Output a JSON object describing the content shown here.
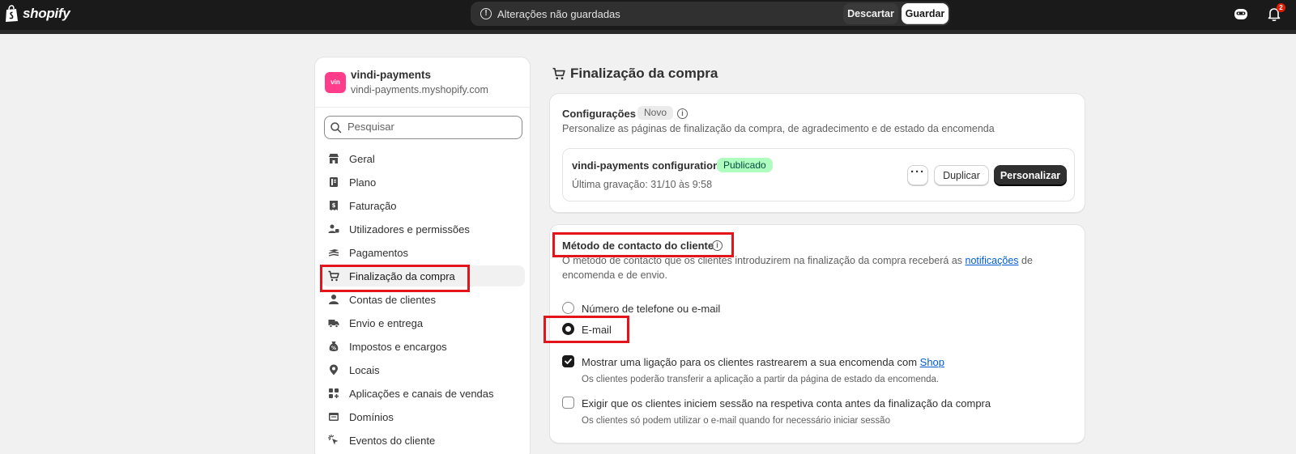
{
  "topbar": {
    "brand": "shopify",
    "unsaved_message": "Alterações não guardadas",
    "discard_label": "Descartar",
    "save_label": "Guardar",
    "notification_count": "2",
    "accent": "#1a1a1a"
  },
  "store": {
    "avatar_text": "vin",
    "name": "vindi-payments",
    "domain": "vindi-payments.myshopify.com"
  },
  "search": {
    "placeholder": "Pesquisar"
  },
  "sidebar": {
    "items": [
      {
        "label": "Geral",
        "icon": "store-icon"
      },
      {
        "label": "Plano",
        "icon": "plan-icon"
      },
      {
        "label": "Faturação",
        "icon": "receipt-icon"
      },
      {
        "label": "Utilizadores e permissões",
        "icon": "users-icon"
      },
      {
        "label": "Pagamentos",
        "icon": "payment-icon"
      },
      {
        "label": "Finalização da compra",
        "icon": "cart-icon",
        "active": true
      },
      {
        "label": "Contas de clientes",
        "icon": "person-icon"
      },
      {
        "label": "Envio e entrega",
        "icon": "truck-icon"
      },
      {
        "label": "Impostos e encargos",
        "icon": "tax-icon"
      },
      {
        "label": "Locais",
        "icon": "location-icon"
      },
      {
        "label": "Aplicações e canais de vendas",
        "icon": "apps-icon"
      },
      {
        "label": "Domínios",
        "icon": "globe-icon"
      },
      {
        "label": "Eventos do cliente",
        "icon": "cursor-icon"
      }
    ]
  },
  "page": {
    "title": "Finalização da compra"
  },
  "config_card": {
    "title": "Configurações",
    "badge": "Novo",
    "description": "Personalize as páginas de finalização da compra, de agradecimento e de estado da encomenda",
    "config_name": "vindi-payments configuration",
    "status": "Publicado",
    "last_saved": "Última gravação: 31/10 às 9:58",
    "more_label": "···",
    "duplicate_label": "Duplicar",
    "customize_label": "Personalizar"
  },
  "contact_card": {
    "title": "Método de contacto do cliente",
    "desc_line1_prefix": "O método de contacto que os clientes introduzirem na finalização da compra receberá as",
    "desc_link": "notificações",
    "desc_line1_suffix": "de",
    "desc_line2": "encomenda e de envio.",
    "option_phone_or_email": "Número de telefone ou e-mail",
    "option_email": "E-mail",
    "shop_tracking_prefix": "Mostrar uma ligação para os clientes rastrearem a sua encomenda com",
    "shop_tracking_link": "Shop",
    "shop_tracking_help": "Os clientes poderão transferir a aplicação a partir da página de estado da encomenda.",
    "require_login_label": "Exigir que os clientes iniciem sessão na respetiva conta antes da finalização da compra",
    "require_login_help": "Os clientes só podem utilizar o e-mail quando for necessário iniciar sessão"
  }
}
